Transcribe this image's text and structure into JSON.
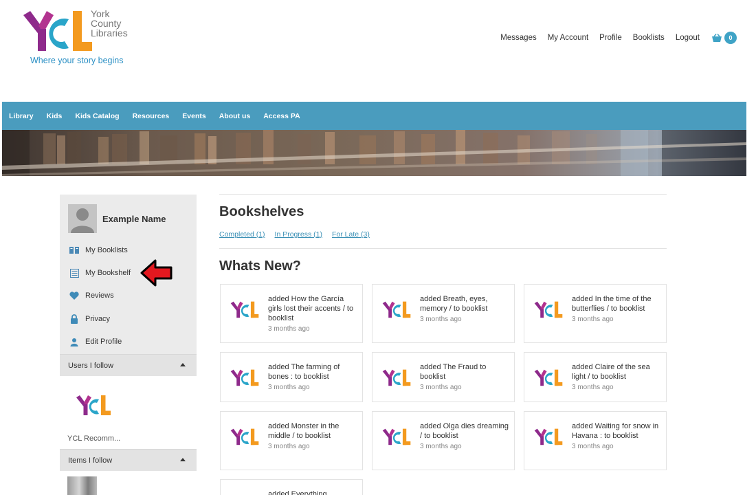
{
  "brand": {
    "line1": "York",
    "line2": "County",
    "line3": "Libraries",
    "tagline": "Where your story begins",
    "colors": {
      "purple": "#8e2a8b",
      "blue": "#2aa5c9",
      "orange": "#f39a1f",
      "nav": "#4a9cbe"
    }
  },
  "top_nav": {
    "items": [
      "Messages",
      "My Account",
      "Profile",
      "Booklists",
      "Logout"
    ],
    "cart_count": "0",
    "cart_icon": "basket-icon"
  },
  "main_nav": {
    "items": [
      "Library",
      "Kids",
      "Kids Catalog",
      "Resources",
      "Events",
      "About us",
      "Access PA"
    ]
  },
  "sidebar": {
    "profile_name": "Example Name",
    "menu": [
      {
        "label": "My Booklists",
        "icon": "book-open-icon"
      },
      {
        "label": "My Bookshelf",
        "icon": "list-icon"
      },
      {
        "label": "Reviews",
        "icon": "heart-icon"
      },
      {
        "label": "Privacy",
        "icon": "lock-icon"
      },
      {
        "label": "Edit Profile",
        "icon": "user-icon"
      }
    ],
    "users_follow": {
      "header": "Users I follow",
      "items": [
        {
          "name": "YCL Recomm..."
        }
      ]
    },
    "items_follow": {
      "header": "Items I follow"
    }
  },
  "main": {
    "bookshelves_title": "Bookshelves",
    "shelf_links": [
      "Completed (1)",
      "In Progress (1)",
      "For Late (3)"
    ],
    "whats_new_title": "Whats New?",
    "activity": [
      {
        "text": "added How the García girls lost their accents / to booklist",
        "time": "3 months ago"
      },
      {
        "text": "added Breath, eyes, memory / to booklist",
        "time": "3 months ago"
      },
      {
        "text": "added In the time of the butterflies / to booklist",
        "time": "3 months ago"
      },
      {
        "text": "added The farming of bones : to booklist",
        "time": "3 months ago"
      },
      {
        "text": "added The Fraud to booklist",
        "time": "3 months ago"
      },
      {
        "text": "added Claire of the sea light / to booklist",
        "time": "3 months ago"
      },
      {
        "text": "added Monster in the middle / to booklist",
        "time": "3 months ago"
      },
      {
        "text": "added Olga dies dreaming / to booklist",
        "time": "3 months ago"
      },
      {
        "text": "added Waiting for snow in Havana : to booklist",
        "time": "3 months ago"
      },
      {
        "text": "added Everything",
        "time": ""
      }
    ]
  }
}
